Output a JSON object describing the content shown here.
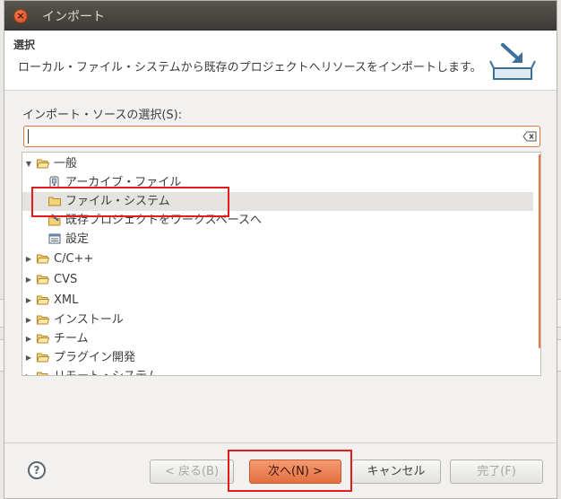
{
  "window": {
    "title": "インポート"
  },
  "header": {
    "title": "選択",
    "description": "ローカル・ファイル・システムから既存のプロジェクトへリソースをインポートします。",
    "icon": "import-wizard-icon"
  },
  "source": {
    "label": "インポート・ソースの選択(S):",
    "filter_value": "",
    "filter_placeholder": ""
  },
  "tree": {
    "general": "一般",
    "archive_file": "アーカイブ・ファイル",
    "file_system": "ファイル・システム",
    "existing_projects": "既存プロジェクトをワークスペースへ",
    "preferences": "設定",
    "cc": "C/C++",
    "cvs": "CVS",
    "xml": "XML",
    "install": "インストール",
    "team": "チーム",
    "plugin_dev": "プラグイン開発",
    "remote_systems": "リモート・システム"
  },
  "buttons": {
    "help": "?",
    "back": "< 戻る(B)",
    "next": "次へ(N) >",
    "cancel": "キャンセル",
    "finish": "完了(F)"
  },
  "colors": {
    "accent": "#e9753f",
    "highlight_box": "#e31b1b"
  }
}
